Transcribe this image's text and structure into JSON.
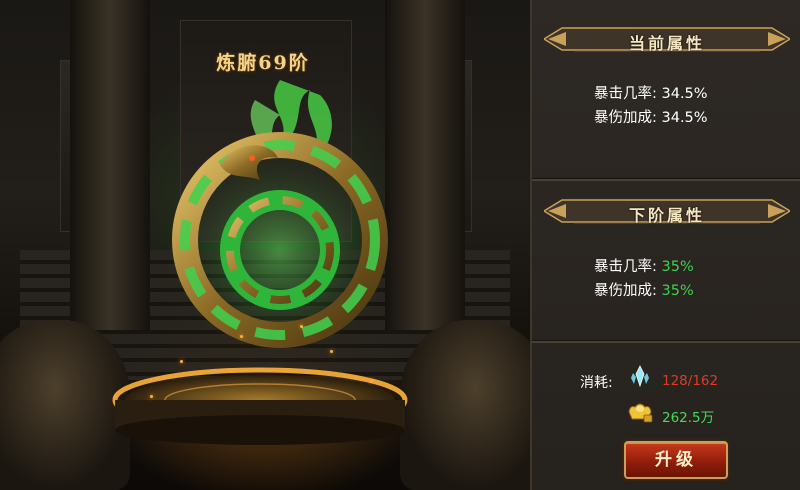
{
  "scene": {
    "title": "炼腑69阶"
  },
  "current_attrs": {
    "header": "当前属性",
    "items": [
      {
        "label": "暴击几率:",
        "value": "34.5%"
      },
      {
        "label": "暴伤加成:",
        "value": "34.5%"
      }
    ]
  },
  "next_attrs": {
    "header": "下阶属性",
    "items": [
      {
        "label": "暴击几率:",
        "value": "35%"
      },
      {
        "label": "暴伤加成:",
        "value": "35%"
      }
    ]
  },
  "cost": {
    "label": "消耗:",
    "crystal": {
      "icon": "crystal-icon",
      "value": "128/162",
      "color": "#e23a2a"
    },
    "gold": {
      "icon": "gold-ingot-icon",
      "value": "262.5万",
      "color": "#49d858"
    }
  },
  "upgrade_button": {
    "label": "升级"
  },
  "colors": {
    "accent_gold": "#caa15a",
    "value_green": "#3fd14d",
    "insufficient_red": "#e23a2a",
    "button_red": "#8d1c0a"
  }
}
